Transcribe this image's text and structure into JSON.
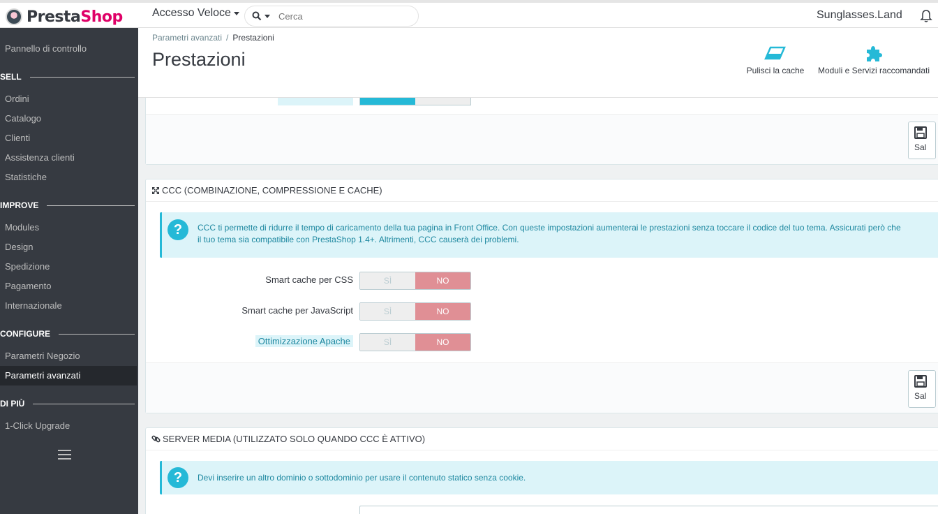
{
  "header": {
    "logo_part1": "Presta",
    "logo_part2": "Shop",
    "quick_access": "Accesso Veloce",
    "search_placeholder": "Cerca",
    "shop_name": "Sunglasses.Land"
  },
  "sidebar": {
    "dashboard": "Pannello di controllo",
    "sections": [
      {
        "title": "SELL",
        "items": [
          "Ordini",
          "Catalogo",
          "Clienti",
          "Assistenza clienti",
          "Statistiche"
        ]
      },
      {
        "title": "IMPROVE",
        "items": [
          "Modules",
          "Design",
          "Spedizione",
          "Pagamento",
          "Internazionale"
        ]
      },
      {
        "title": "CONFIGURE",
        "items": [
          "Parametri Negozio",
          "Parametri avanzati"
        ]
      },
      {
        "title": "DI PIÙ",
        "items": [
          "1-Click Upgrade"
        ]
      }
    ],
    "active_item": "Parametri avanzati"
  },
  "page": {
    "breadcrumb_parent": "Parametri avanzati",
    "breadcrumb_separator": "/",
    "breadcrumb_current": "Prestazioni",
    "title": "Prestazioni",
    "toolbar": {
      "clear_cache": "Pulisci la cache",
      "recommended": "Moduli e Servizi raccomandati"
    }
  },
  "panels": {
    "save_label": "Sal",
    "ccc": {
      "title": "CCC (COMBINAZIONE, COMPRESSIONE E CACHE)",
      "info_line1": "CCC ti permette di ridurre il tempo di caricamento della tua pagina in Front Office. Con queste impostazioni aumenterai le prestazioni senza toccare il codice del tuo tema. Assicurati però che",
      "info_line2": "il tuo tema sia compatibile con PrestaShop 1.4+. Altrimenti, CCC causerà dei problemi.",
      "rows": [
        {
          "label": "Smart cache per CSS",
          "yes": "SÌ",
          "no": "NO"
        },
        {
          "label": "Smart cache per JavaScript",
          "yes": "SÌ",
          "no": "NO"
        },
        {
          "label": "Ottimizzazione Apache",
          "yes": "SÌ",
          "no": "NO"
        }
      ]
    },
    "media": {
      "title": "SERVER MEDIA (UTILIZZATO SOLO QUANDO CCC È ATTIVO)",
      "info": "Devi inserire un altro dominio o sottodominio per usare il contenuto statico senza cookie."
    }
  },
  "colors": {
    "sidebar_bg": "#363a41",
    "accent": "#25b9d7",
    "switch_no": "#e08f95",
    "brand_pink": "#df0067"
  }
}
